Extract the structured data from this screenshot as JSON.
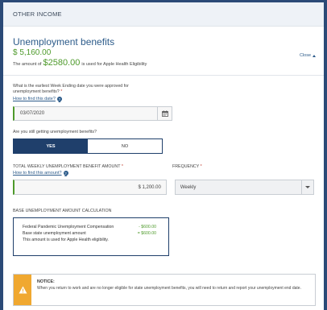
{
  "section": {
    "header": "OTHER INCOME"
  },
  "benefit": {
    "title": "Unemployment benefits",
    "amount": "$ 5,160.00",
    "close_label": "Close",
    "eligibility_prefix": "The amount of",
    "eligibility_amount": "$2580.00",
    "eligibility_suffix": "is used for Apple Health Eligibility"
  },
  "week_question": {
    "label": "What is the earliest Week Ending date you were approved for unemployment benefits?",
    "required_mark": "*",
    "help_link": "How to find this date?",
    "help_icon": "?",
    "value": "03/07/2020",
    "icon": "calendar-icon"
  },
  "still_getting": {
    "label": "Are you still getting unemployment benefits?",
    "options": [
      "YES",
      "NO"
    ],
    "selected": "YES"
  },
  "weekly_amount": {
    "label": "TOTAL WEEKLY UNEMPLOYMENT BENEFIT AMOUNT",
    "required_mark": "*",
    "help_link": "How to find this amount?",
    "help_icon": "?",
    "value": "$ 1,200.00"
  },
  "frequency": {
    "label": "FREQUENCY",
    "required_mark": "*",
    "value": "Weekly"
  },
  "calculation": {
    "title": "BASE UNEMPLOYMENT AMOUNT CALCULATION",
    "rows": [
      {
        "label": "Federal Pandemic Unemployment Compensation",
        "value": "- $600.00"
      },
      {
        "label": "Base state unemployment amount",
        "value": "= $600.00"
      }
    ],
    "note": "This amount is used for Apple Health eligibility."
  },
  "notice": {
    "title": "NOTICE:",
    "text": "When you return to work and are no longer eligible for state unemployment benefits, you will need to return and report your unemployment end date.",
    "icon": "warning-icon"
  },
  "colors": {
    "accent": "#2c5b8a",
    "positive": "#4e9a2b",
    "selected": "#1f3f6b",
    "warning": "#f0a830",
    "background": "#2b4a77"
  }
}
